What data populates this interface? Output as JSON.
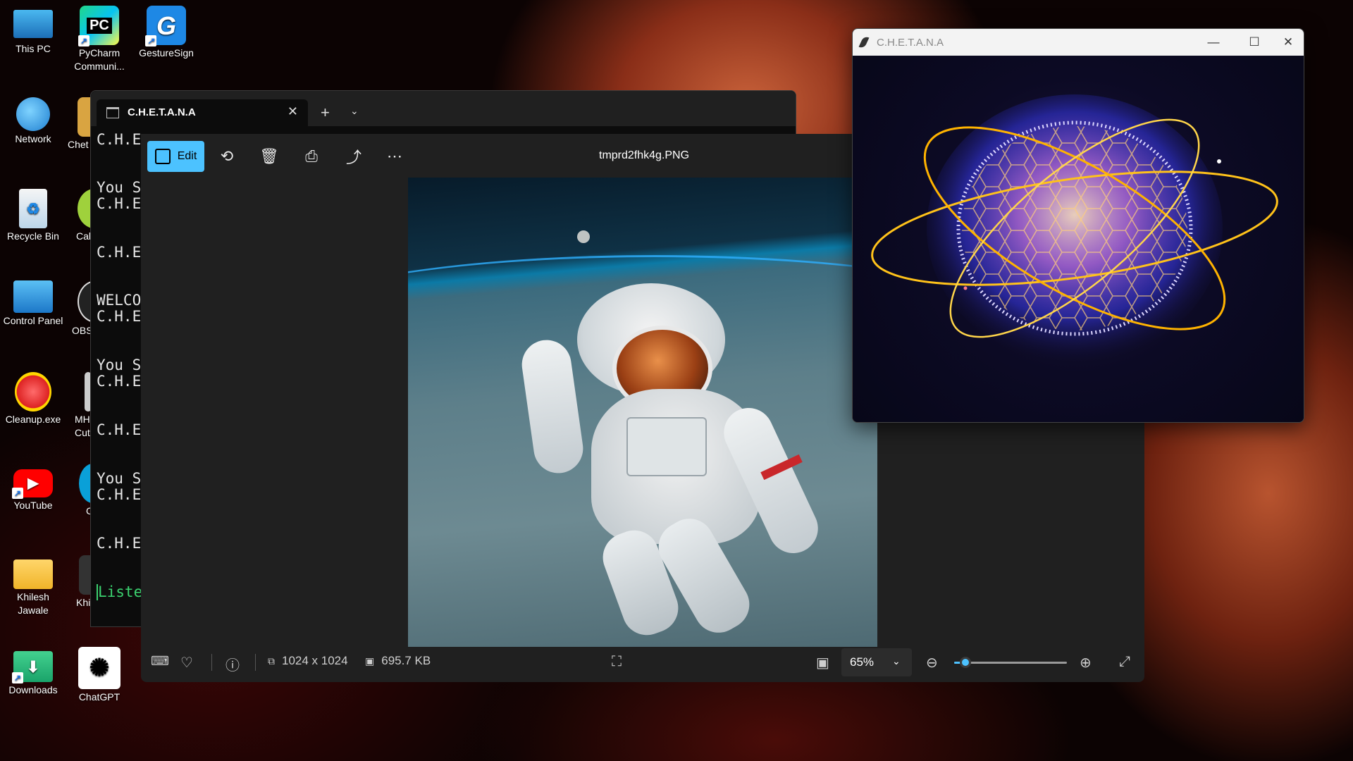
{
  "desktop": {
    "icons": [
      {
        "label": "This PC",
        "icon": "monitor-icon"
      },
      {
        "label": "PyCharm Communi...",
        "icon": "pycharm-icon"
      },
      {
        "label": "GestureSign",
        "icon": "gesturesign-icon"
      },
      {
        "label": "Network",
        "icon": "network-icon"
      },
      {
        "label": "Chet",
        "icon": "shortcut-icon"
      },
      {
        "label": "Recycle Bin",
        "icon": "recycle-bin-icon"
      },
      {
        "label": "Cal",
        "icon": "shortcut-icon"
      },
      {
        "label": "Control Panel",
        "icon": "control-panel-icon"
      },
      {
        "label": "OBS",
        "icon": "obs-icon"
      },
      {
        "label": "Cleanup.exe",
        "icon": "cleanup-icon"
      },
      {
        "label": "MH Cut",
        "icon": "shortcut-icon"
      },
      {
        "label": "YouTube",
        "icon": "youtube-icon"
      },
      {
        "label": "C",
        "icon": "shortcut-icon"
      },
      {
        "label": "Khilesh Jawale",
        "icon": "user-folder-icon"
      },
      {
        "label": "Khi",
        "icon": "shortcut-icon"
      },
      {
        "label": "Downloads",
        "icon": "downloads-icon"
      },
      {
        "label": "ChatGPT",
        "icon": "chatgpt-icon"
      }
    ]
  },
  "terminal": {
    "tab_title": "C.H.E.T.A.N.A",
    "close_glyph": "✕",
    "new_tab_glyph": "+",
    "dropdown_glyph": "⌄",
    "lines": [
      "C.H.E",
      "You S",
      "C.H.E",
      "C.H.E",
      "WELCO",
      "C.H.E",
      "You S",
      "C.H.E",
      "C.H.E",
      "You S",
      "C.H.E",
      "C.H.E",
      "Liste"
    ]
  },
  "photos": {
    "edit_label": "Edit",
    "filename": "tmprd2fhk4g.PNG",
    "toolbar_icons": [
      "rotate-icon",
      "delete-icon",
      "print-icon",
      "share-icon",
      "more-icon"
    ],
    "dimensions": "1024 x 1024",
    "file_size": "695.7 KB",
    "zoom_label": "65%",
    "zoom_level": 0.1
  },
  "chetana_window": {
    "title": "C.H.E.T.A.N.A",
    "minimize_glyph": "—",
    "maximize_glyph": "☐",
    "close_glyph": "✕"
  },
  "colors": {
    "accent": "#4cc2ff",
    "terminal_green": "#3bd16f"
  }
}
